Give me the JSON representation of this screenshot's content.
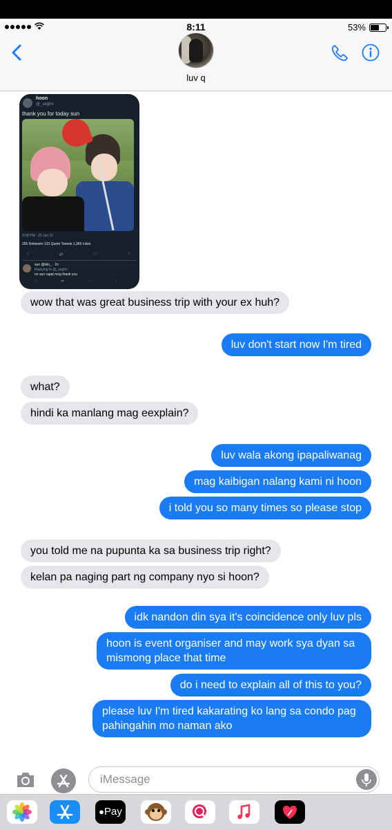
{
  "status_bar": {
    "time": "8:11",
    "battery": "53%"
  },
  "header": {
    "contact_name": "luv q"
  },
  "attachment": {
    "tweet_name": "hoon",
    "tweet_handle": "@_seghn",
    "tweet_text": "thank you for today sun",
    "tweet_meta": "3:08 PM · 25 Jun 22",
    "tweet_stats": "255 Retweets   123 Quote Tweets   1,366 Likes",
    "reply_name": "sun @kilo_ · 1h",
    "reply_to": "Replying to @_seghn",
    "reply_text": "no sun rapat mog thank you"
  },
  "messages": [
    {
      "side": "in",
      "text": "wow that was great business trip with your ex huh?"
    },
    {
      "side": "out",
      "text": "luv don't start now I'm tired"
    },
    {
      "side": "in",
      "text": "what?"
    },
    {
      "side": "in",
      "text": "hindi ka manlang mag eexplain?"
    },
    {
      "side": "out",
      "text": "luv wala akong ipapaliwanag"
    },
    {
      "side": "out",
      "text": "mag kaibigan nalang kami ni hoon"
    },
    {
      "side": "out",
      "text": "i told you so many times so please stop"
    },
    {
      "side": "in",
      "text": "you told me na pupunta ka sa business trip right?"
    },
    {
      "side": "in",
      "text": "kelan pa naging part ng company nyo si hoon?"
    },
    {
      "side": "out",
      "text": "idk nandon din sya it's coincidence only luv pls"
    },
    {
      "side": "out",
      "text": "hoon is event organiser and may work sya dyan sa mismong place that time"
    },
    {
      "side": "out",
      "text": "do i need to explain all of this to you?"
    },
    {
      "side": "out",
      "text": "please luv I'm tired kakarating ko lang sa condo pag pahingahin mo naman ako"
    }
  ],
  "composer": {
    "placeholder": "iMessage"
  },
  "drawer": {
    "apple_pay_label": "Pay"
  },
  "colors": {
    "outgoing_bubble": "#1a7cf5",
    "incoming_bubble": "#e5e5ea",
    "accent": "#1a7cf5"
  }
}
